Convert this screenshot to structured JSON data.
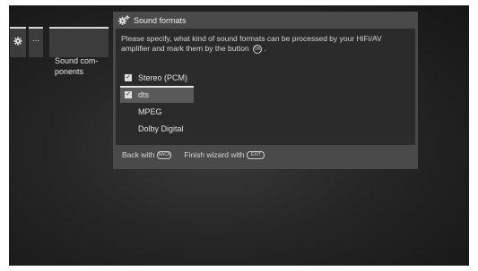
{
  "breadcrumb": {
    "more_label": "...",
    "title": "Sound com-\nponents"
  },
  "dialog": {
    "title": "Sound formats",
    "instruction": "Please specify, what kind of sound formats can be processed by your HiFi/AV amplifier and mark them by the button",
    "instruction_end": ".",
    "ok_glyph": "OK",
    "formats": [
      {
        "label": "Stereo (PCM)",
        "checked": true,
        "selected": false
      },
      {
        "label": "dts",
        "checked": true,
        "selected": true
      },
      {
        "label": "MPEG",
        "checked": false,
        "selected": false
      },
      {
        "label": "Dolby Digital",
        "checked": false,
        "selected": false
      }
    ],
    "footer": {
      "back_label": "Back with",
      "back_key": "BACK",
      "finish_label": "Finish wizard with",
      "finish_key": "EXIT"
    }
  },
  "icons": {
    "settings": "gear-icon",
    "check": "checkmark-icon"
  },
  "colors": {
    "dialog_bg": "#4a4a4a",
    "content_bg": "#2b2b2b",
    "selected_row": "#5a5a5a",
    "breadcrumb_bg": "#3c3c3c"
  }
}
